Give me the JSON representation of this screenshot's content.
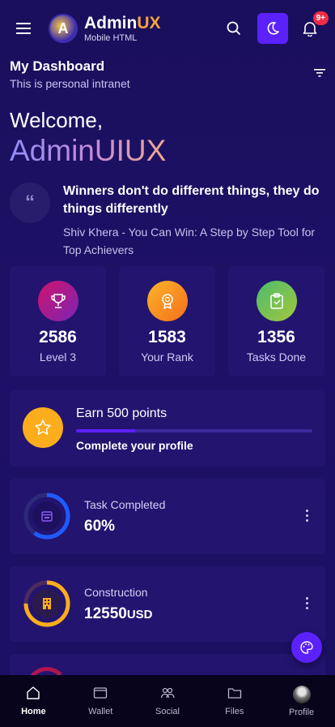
{
  "header": {
    "brand_main": "Admin",
    "brand_accent": "UX",
    "brand_sub": "Mobile HTML",
    "logo_letter": "A",
    "notification_count": "9+"
  },
  "dashboard": {
    "title": "My Dashboard",
    "subtitle": "This is personal intranet"
  },
  "welcome": {
    "greeting": "Welcome,",
    "name": "AdminUIUX"
  },
  "quote": {
    "icon": "quote-icon",
    "text": "Winners don't do different things, they do things differently",
    "author": "Shiv Khera - You Can Win: A Step by Step Tool for Top Achievers"
  },
  "stats": [
    {
      "value": "2586",
      "label": "Level 3",
      "icon": "trophy-icon",
      "color": "#c0188a"
    },
    {
      "value": "1583",
      "label": "Your Rank",
      "icon": "award-icon",
      "color": "#fb8c1e"
    },
    {
      "value": "1356",
      "label": "Tasks Done",
      "icon": "clipboard-check-icon",
      "color": "#5cc36e"
    }
  ],
  "earn": {
    "title": "Earn 500 points",
    "subtitle": "Complete your profile",
    "progress": 0.25,
    "icon": "star-icon"
  },
  "task_card": {
    "label": "Task Completed",
    "value": "60%",
    "progress": 0.6,
    "color": "#1e5bff"
  },
  "construction_card": {
    "label": "Construction",
    "value": "12550",
    "unit": "USD",
    "progress": 0.75,
    "color": "#fbad1c"
  },
  "footer": {
    "tabs": [
      {
        "label": "Home",
        "icon": "home-icon",
        "active": true
      },
      {
        "label": "Wallet",
        "icon": "wallet-icon",
        "active": false
      },
      {
        "label": "Social",
        "icon": "people-icon",
        "active": false
      },
      {
        "label": "Files",
        "icon": "folder-icon",
        "active": false
      },
      {
        "label": "Profile",
        "icon": "avatar",
        "active": false
      }
    ]
  },
  "colors": {
    "background": "#1a0f5c",
    "card": "#231470",
    "accent": "#5b21ff",
    "badge": "#ef2c46"
  }
}
